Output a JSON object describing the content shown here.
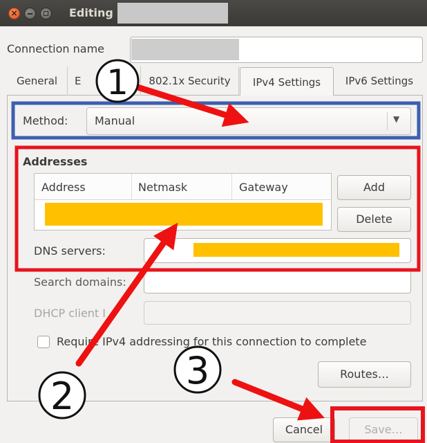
{
  "window": {
    "title": "Editing"
  },
  "connection": {
    "label": "Connection name"
  },
  "tabs": [
    {
      "label": "General"
    },
    {
      "label": "E"
    },
    {
      "label": "802.1x Security"
    },
    {
      "label": "IPv4 Settings"
    },
    {
      "label": "IPv6 Settings"
    }
  ],
  "method": {
    "label": "Method:",
    "value": "Manual"
  },
  "addresses": {
    "title": "Addresses",
    "columns": [
      "Address",
      "Netmask",
      "Gateway"
    ],
    "add_label": "Add",
    "delete_label": "Delete"
  },
  "dns": {
    "label": "DNS servers:"
  },
  "search_domains": {
    "label": "Search domains:"
  },
  "dhcp": {
    "label": "DHCP client I"
  },
  "require_ipv4": {
    "label": "Require IPv4 addressing for this connection to complete"
  },
  "routes": {
    "label": "Routes…"
  },
  "footer": {
    "cancel_label": "Cancel",
    "save_label": "Save…"
  },
  "annotations": {
    "step1": "1",
    "step2": "2",
    "step3": "3",
    "arrow_color": "#ee1111",
    "ipv4_box_color": "#3c5fb0",
    "addresses_box_color": "#e8141c",
    "save_box_color": "#e8141c",
    "redaction_color": "#ffc000"
  }
}
